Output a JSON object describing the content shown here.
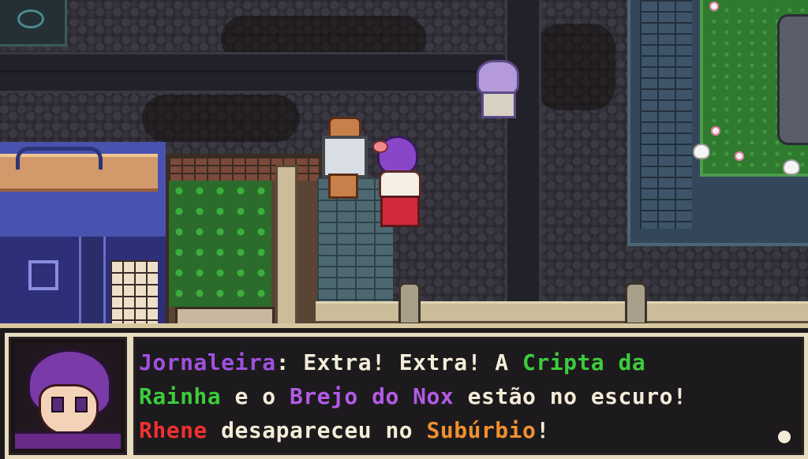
{
  "dialogue": {
    "lines": [
      [
        {
          "text": "Jornaleira",
          "color": "#a050e0"
        },
        {
          "text": ": Extra! Extra! A ",
          "color": "#f4ecd8"
        },
        {
          "text": "Cripta da",
          "color": "#3ccc3c"
        }
      ],
      [
        {
          "text": "Rainha",
          "color": "#3ccc3c"
        },
        {
          "text": " e o ",
          "color": "#f4ecd8"
        },
        {
          "text": "Brejo do Nox",
          "color": "#b45ae6"
        },
        {
          "text": " estão no escuro!",
          "color": "#f4ecd8"
        }
      ],
      [
        {
          "text": "Rhene",
          "color": "#f03030"
        },
        {
          "text": " desapareceu no ",
          "color": "#f4ecd8"
        },
        {
          "text": "Subúrbio",
          "color": "#f09030"
        },
        {
          "text": "!",
          "color": "#f4ecd8"
        }
      ]
    ],
    "speaker_icon": "newsgirl-portrait"
  },
  "colors": {
    "frame": "#e8dcc0",
    "text": "#f4ecd8",
    "background": "#1c1a1c"
  }
}
